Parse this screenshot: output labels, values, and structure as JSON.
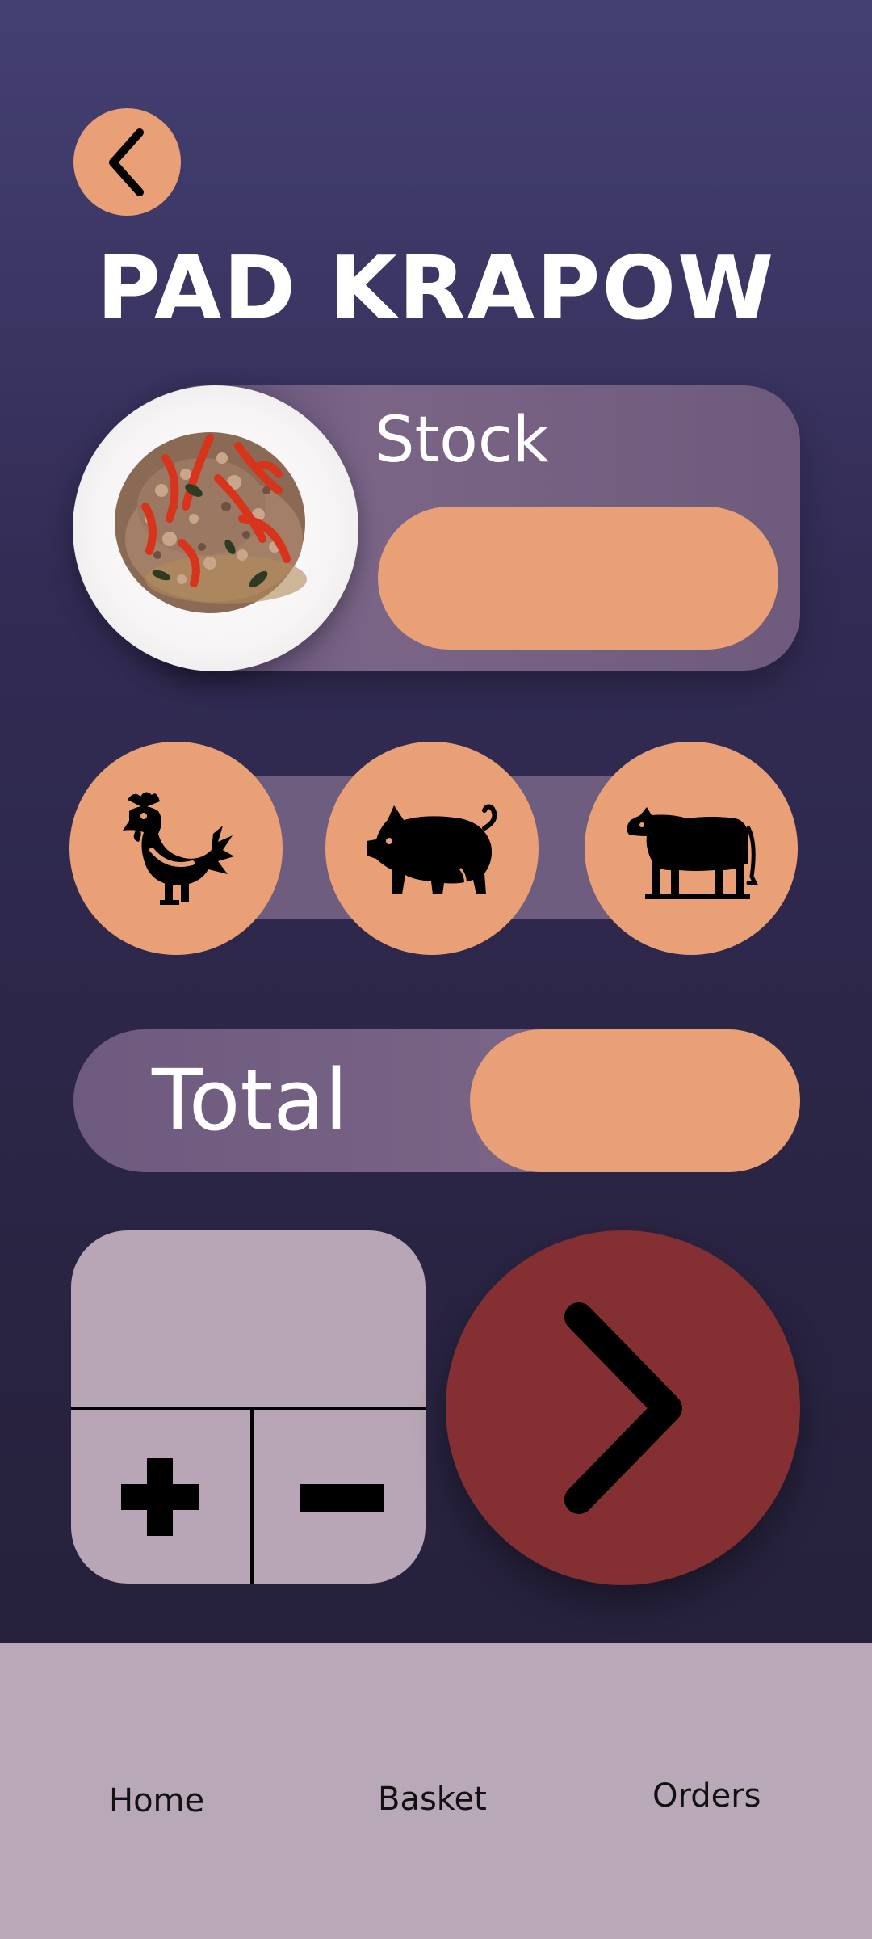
{
  "header": {
    "title": "PAD KRAPOW",
    "back_icon": "chevron-left-icon"
  },
  "product": {
    "image": "pad-krapow-plate",
    "stock_label": "Stock",
    "stock_value": ""
  },
  "meat_options": [
    {
      "name": "chicken",
      "icon": "chicken-icon"
    },
    {
      "name": "pork",
      "icon": "pig-icon"
    },
    {
      "name": "beef",
      "icon": "cow-icon"
    }
  ],
  "total": {
    "label": "Total",
    "value": ""
  },
  "quantity": {
    "value": "",
    "plus_icon": "plus-icon",
    "minus_icon": "minus-icon"
  },
  "next_icon": "chevron-right-icon",
  "nav": {
    "home": "Home",
    "basket": "Basket",
    "orders": "Orders"
  },
  "colors": {
    "accent": "#e9a077",
    "panel": "#7a6486",
    "next_button": "#842f31",
    "nav_background": "#b9a8b8",
    "quantity_box": "#b8a6b6"
  }
}
